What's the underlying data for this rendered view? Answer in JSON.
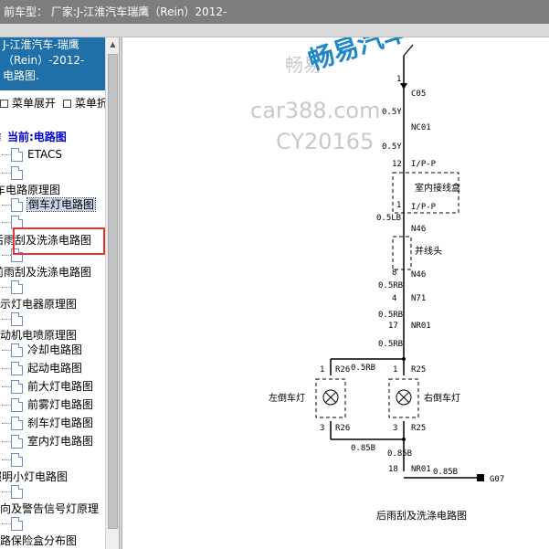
{
  "header": {
    "title": "前车型：  厂家:J-江淮汽车瑞鹰（Rein）2012-"
  },
  "sidebar": {
    "panel_title": [
      "J-江淮汽车-瑞鹰",
      "（Rein）-2012-",
      "电路图."
    ],
    "expand_label": "菜单展开",
    "collapse_label": "菜单折",
    "current_label": "当前:电路图",
    "items": [
      {
        "label": "ETACS"
      },
      {
        "label": ""
      },
      {
        "label": "车电路原理图"
      },
      {
        "label": "倒车灯电路图"
      },
      {
        "label": ""
      },
      {
        "label": "后雨刮及洗涤电路图"
      },
      {
        "label": ""
      },
      {
        "label": "前雨刮及洗涤电路图"
      },
      {
        "label": ""
      },
      {
        "label": "指示灯电器原理图"
      },
      {
        "label": ""
      },
      {
        "label": "发动机电喷原理图"
      },
      {
        "label": "冷却电路图"
      },
      {
        "label": "起动电路图"
      },
      {
        "label": "前大灯电路图"
      },
      {
        "label": "前雾灯电路图"
      },
      {
        "label": "刹车灯电路图"
      },
      {
        "label": "室内灯电路图"
      },
      {
        "label": ""
      },
      {
        "label": "照明小灯电路图"
      },
      {
        "label": ""
      },
      {
        "label": "转向及警告信号灯原理"
      },
      {
        "label": ""
      },
      {
        "label": "电路保险盒分布图"
      }
    ]
  },
  "watermarks": {
    "w1": "畅易",
    "w2": "car388.com",
    "w3": "CY20165",
    "brand": "畅易汽车"
  },
  "diagram": {
    "caption": "后雨刮及洗涤电路图",
    "connector_top": "C05",
    "wires": {
      "w1": "0.5Y",
      "w2": "0.5Y",
      "w3": "0.5LB",
      "w4": "0.5RB",
      "w5": "0.5RB",
      "w6": "0.5RB",
      "w7": "0.5RB",
      "w8": "0.85B",
      "w9": "0.85B",
      "w10": "0.85B"
    },
    "pins": {
      "p1": "1",
      "p2": "12",
      "p3": "1",
      "p4": "8",
      "p5": "8",
      "p6": "4",
      "p7": "17",
      "p8": "1",
      "p9": "1",
      "p10": "3",
      "p11": "3",
      "p12": "18"
    },
    "connectors": {
      "nc01": "NC01",
      "ip1": "I/P-P",
      "ip2": "I/P-P",
      "n46a": "N46",
      "n46b": "N46",
      "n71": "N71",
      "nr01": "NR01",
      "r26a": "R26",
      "r25a": "R25",
      "r26b": "R26",
      "r25b": "R25",
      "nr01b": "NR01",
      "g07": "G07"
    },
    "labels": {
      "fuse_box": "室内接线盒",
      "joint": "并线头",
      "left_lamp": "左倒车灯",
      "right_lamp": "右倒车灯"
    }
  }
}
